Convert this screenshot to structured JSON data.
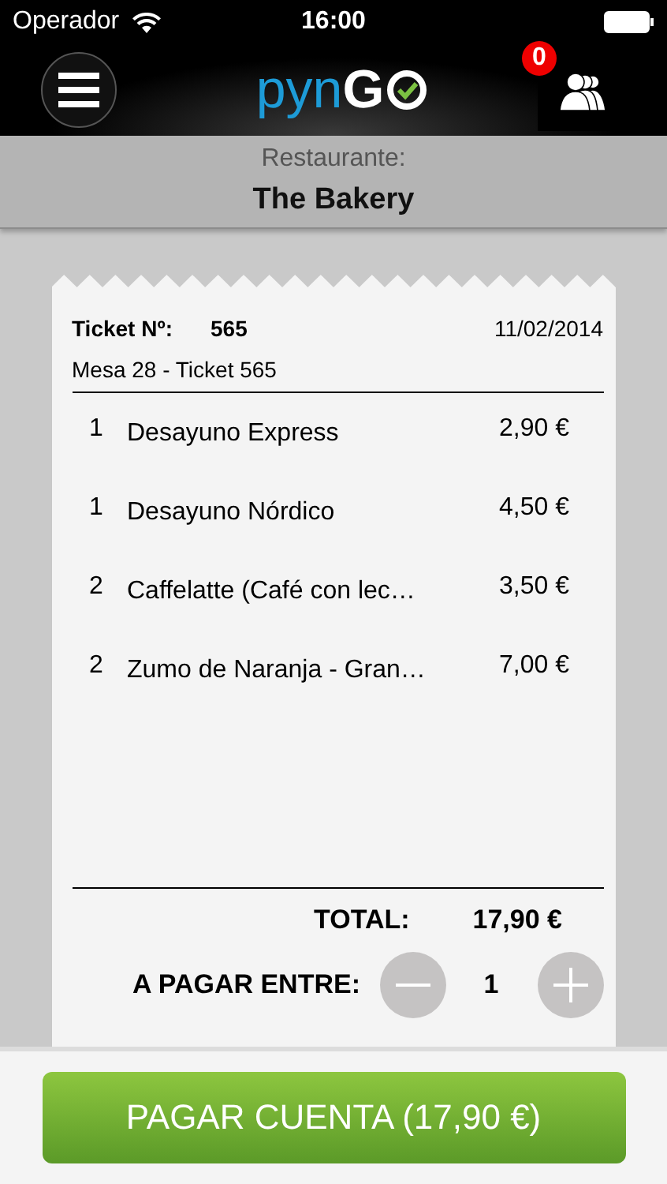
{
  "status_bar": {
    "carrier": "Operador",
    "time": "16:00"
  },
  "header": {
    "logo": {
      "part_1": "pyn",
      "part_2": "G"
    },
    "notification_count": "0"
  },
  "restaurant": {
    "label": "Restaurante:",
    "name": "The Bakery"
  },
  "ticket": {
    "number_label": "Ticket Nº:",
    "number": "565",
    "date": "11/02/2014",
    "subtitle": "Mesa 28 - Ticket 565",
    "items": [
      {
        "qty": "1",
        "name": "Desayuno Express",
        "price": "2,90 €"
      },
      {
        "qty": "1",
        "name": "Desayuno Nórdico",
        "price": "4,50 €"
      },
      {
        "qty": "2",
        "name": "Caffelatte (Café con lec…",
        "price": "3,50 €"
      },
      {
        "qty": "2",
        "name": "Zumo de Naranja - Gran…",
        "price": "7,00 €"
      }
    ],
    "total_label": "TOTAL:",
    "total": "17,90 €",
    "split": {
      "label": "A PAGAR ENTRE:",
      "count": "1"
    }
  },
  "pay_button": "PAGAR CUENTA (17,90 €)"
}
